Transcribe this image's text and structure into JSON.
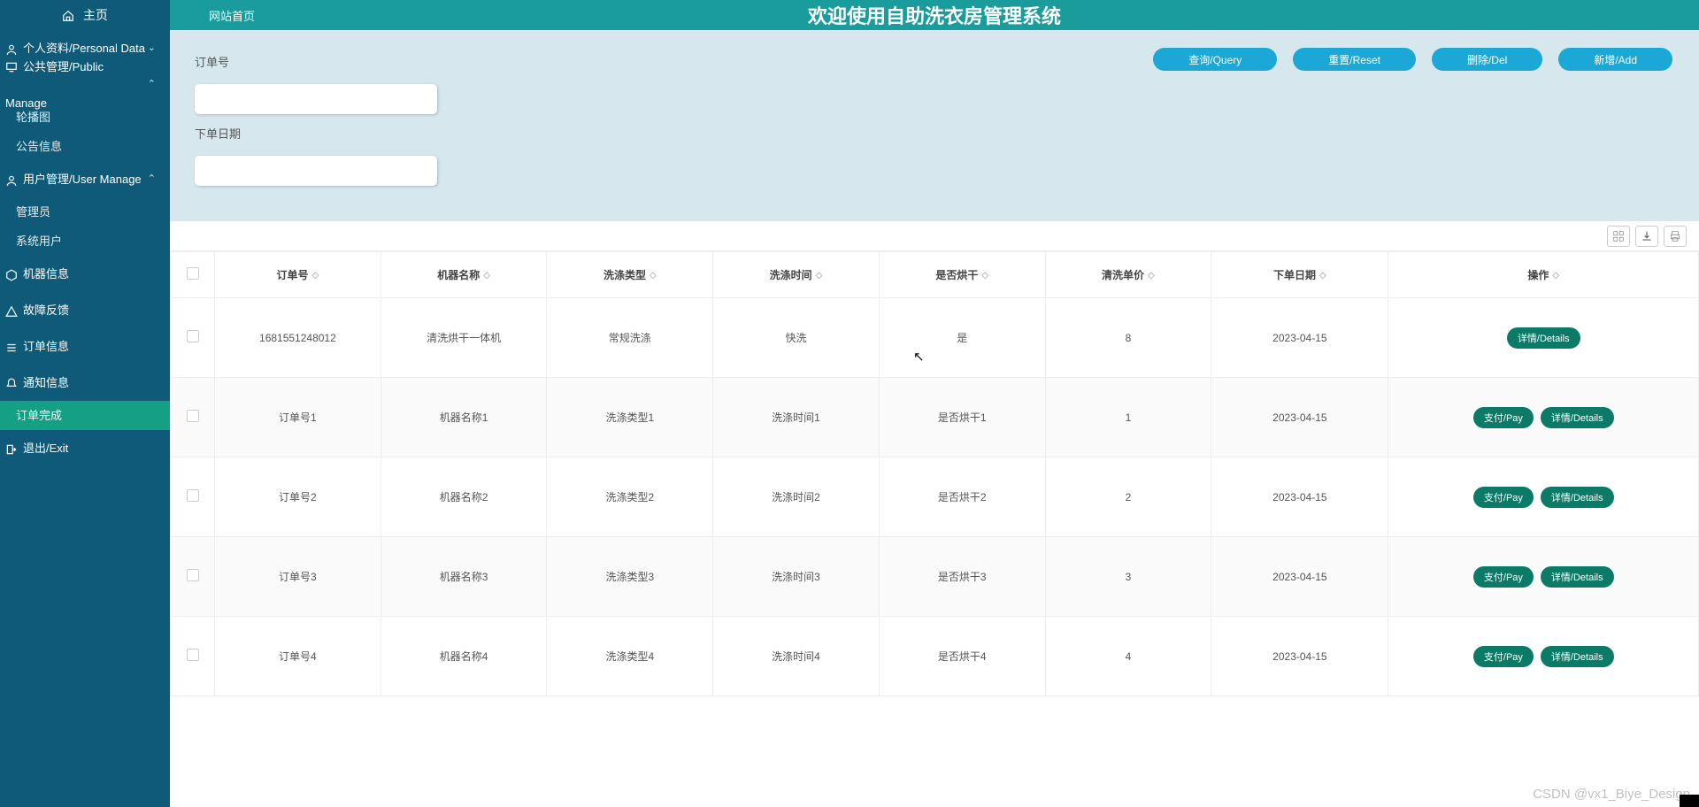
{
  "header": {
    "breadcrumb": "网站首页",
    "title": "欢迎使用自助洗衣房管理系统"
  },
  "sidebar": {
    "home": "主页",
    "sections": [
      {
        "label": "个人资料/Personal Data",
        "expanded": false,
        "items": []
      },
      {
        "label": "公共管理/Public Manage",
        "expanded": true,
        "items": [
          {
            "label": "轮播图"
          },
          {
            "label": "公告信息"
          }
        ]
      },
      {
        "label": "用户管理/User Manage",
        "expanded": true,
        "items": [
          {
            "label": "管理员"
          },
          {
            "label": "系统用户"
          }
        ]
      },
      {
        "label": "机器信息",
        "expanded": false,
        "items": []
      },
      {
        "label": "故障反馈",
        "expanded": false,
        "items": []
      },
      {
        "label": "订单信息",
        "expanded": false,
        "items": []
      },
      {
        "label": "通知信息",
        "expanded": false,
        "items": []
      },
      {
        "label": "订单完成",
        "active": true
      },
      {
        "label": "退出/Exit",
        "expanded": false,
        "items": []
      }
    ]
  },
  "query": {
    "order_label": "订单号",
    "order_value": "",
    "date_label": "下单日期",
    "date_value": "",
    "buttons": {
      "query": "查询/Query",
      "reset": "重置/Reset",
      "delete": "删除/Del",
      "add": "新增/Add"
    }
  },
  "table": {
    "headers": {
      "order": "订单号",
      "machine": "机器名称",
      "type": "洗涤类型",
      "time": "洗涤时间",
      "dry": "是否烘干",
      "price": "清洗单价",
      "date": "下单日期",
      "op": "操作"
    },
    "rows": [
      {
        "order": "1681551248012",
        "machine": "清洗烘干一体机",
        "type": "常规洗涤",
        "time": "快洗",
        "dry": "是",
        "price": "8",
        "date": "2023-04-15",
        "ops": [
          "详情/Details"
        ]
      },
      {
        "order": "订单号1",
        "machine": "机器名称1",
        "type": "洗涤类型1",
        "time": "洗涤时间1",
        "dry": "是否烘干1",
        "price": "1",
        "date": "2023-04-15",
        "ops": [
          "支付/Pay",
          "详情/Details"
        ]
      },
      {
        "order": "订单号2",
        "machine": "机器名称2",
        "type": "洗涤类型2",
        "time": "洗涤时间2",
        "dry": "是否烘干2",
        "price": "2",
        "date": "2023-04-15",
        "ops": [
          "支付/Pay",
          "详情/Details"
        ]
      },
      {
        "order": "订单号3",
        "machine": "机器名称3",
        "type": "洗涤类型3",
        "time": "洗涤时间3",
        "dry": "是否烘干3",
        "price": "3",
        "date": "2023-04-15",
        "ops": [
          "支付/Pay",
          "详情/Details"
        ]
      },
      {
        "order": "订单号4",
        "machine": "机器名称4",
        "type": "洗涤类型4",
        "time": "洗涤时间4",
        "dry": "是否烘干4",
        "price": "4",
        "date": "2023-04-15",
        "ops": [
          "支付/Pay",
          "详情/Details"
        ]
      }
    ]
  },
  "watermark": "CSDN @vx1_Biye_Design"
}
